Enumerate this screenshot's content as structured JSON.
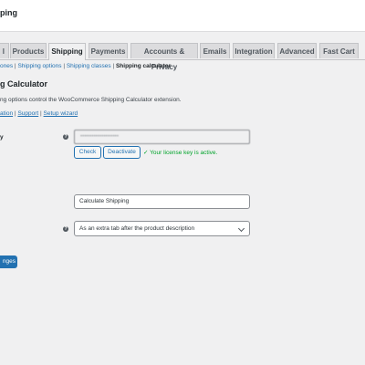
{
  "header": {
    "title": "ping"
  },
  "tabs": [
    {
      "label": "l"
    },
    {
      "label": "Products"
    },
    {
      "label": "Shipping"
    },
    {
      "label": "Payments"
    },
    {
      "label": "Accounts & Privacy"
    },
    {
      "label": "Emails"
    },
    {
      "label": "Integration"
    },
    {
      "label": "Advanced"
    },
    {
      "label": "Fast Cart"
    }
  ],
  "subnav": {
    "items": [
      {
        "label": "ones"
      },
      {
        "label": "Shipping options"
      },
      {
        "label": "Shipping classes"
      },
      {
        "label": "Shipping calculator"
      }
    ],
    "separator": "|"
  },
  "section": {
    "title": "g Calculator",
    "description": "ng options control the WooCommerce Shipping Calculator extension.",
    "links": [
      {
        "label": "ation"
      },
      {
        "label": "Support"
      },
      {
        "label": "Setup wizard"
      }
    ],
    "link_separator": "|"
  },
  "license": {
    "label": "y",
    "help": "?",
    "value": "••••••••••••••••••••",
    "check_label": "Check",
    "deactivate_label": "Deactivate",
    "status": "✓ Your license key is active."
  },
  "button_text": {
    "value": "Calculate Shipping"
  },
  "display": {
    "help": "?",
    "selected": "As an extra tab after the product description"
  },
  "save": {
    "label": "nges"
  },
  "colors": {
    "accent": "#2271b1",
    "success": "#00a32a",
    "background": "#f0f0f1"
  }
}
